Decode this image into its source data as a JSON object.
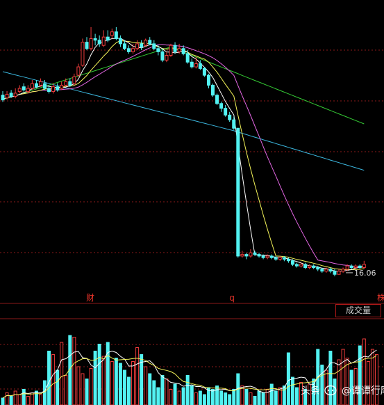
{
  "colors": {
    "up": "#f03c3c",
    "down": "#52f2f2",
    "ma5": "#ffffff",
    "ma10": "#f5f55a",
    "ma20": "#e467e4",
    "ma60": "#34c934",
    "ma120": "#3cb8e0",
    "grid": "#8b1a1a",
    "label": "#e8342a"
  },
  "main_panel": {
    "event_markers": [
      {
        "label": "财",
        "x_index": 30
      },
      {
        "label": "q",
        "x_index": 78
      },
      {
        "label": "株",
        "x_index": 128
      }
    ],
    "low_annotation": "16.06"
  },
  "volume_panel": {
    "title": "成交量"
  },
  "watermark": {
    "prefix": "头条",
    "at": "@",
    "account": "谭谭行摩"
  },
  "chart_data": [
    {
      "type": "candlestick",
      "xlabel": "",
      "ylabel": "",
      "y_scale_note": "price axis not printed",
      "grid": "horizontal dashed",
      "candles": [
        {
          "o": 61.6,
          "c": 60.4,
          "h": 62.6,
          "l": 59.9
        },
        {
          "o": 60.9,
          "c": 61.8,
          "h": 62.6,
          "l": 60.5
        },
        {
          "o": 62.1,
          "c": 61.3,
          "h": 62.9,
          "l": 60.9
        },
        {
          "o": 61.3,
          "c": 62.1,
          "h": 63.3,
          "l": 60.8
        },
        {
          "o": 62.5,
          "c": 63.3,
          "h": 64.1,
          "l": 62.0
        },
        {
          "o": 63.7,
          "c": 62.9,
          "h": 64.6,
          "l": 62.5
        },
        {
          "o": 62.5,
          "c": 63.3,
          "h": 64.1,
          "l": 62.0
        },
        {
          "o": 63.3,
          "c": 64.5,
          "h": 65.4,
          "l": 62.9
        },
        {
          "o": 64.5,
          "c": 63.7,
          "h": 65.4,
          "l": 63.3
        },
        {
          "o": 64.1,
          "c": 65.0,
          "h": 65.8,
          "l": 63.7
        },
        {
          "o": 64.5,
          "c": 63.3,
          "h": 65.4,
          "l": 62.9
        },
        {
          "o": 63.3,
          "c": 62.5,
          "h": 64.1,
          "l": 62.0
        },
        {
          "o": 62.5,
          "c": 63.7,
          "h": 64.6,
          "l": 62.0
        },
        {
          "o": 63.7,
          "c": 62.9,
          "h": 64.6,
          "l": 62.5
        },
        {
          "o": 63.3,
          "c": 64.1,
          "h": 65.0,
          "l": 62.9
        },
        {
          "o": 64.1,
          "c": 65.0,
          "h": 65.8,
          "l": 63.7
        },
        {
          "o": 65.0,
          "c": 64.1,
          "h": 65.8,
          "l": 63.7
        },
        {
          "o": 64.5,
          "c": 66.2,
          "h": 67.0,
          "l": 64.1
        },
        {
          "o": 66.6,
          "c": 68.7,
          "h": 69.5,
          "l": 66.2
        },
        {
          "o": 69.1,
          "c": 74.9,
          "h": 75.8,
          "l": 68.7
        },
        {
          "o": 74.9,
          "c": 73.3,
          "h": 76.2,
          "l": 72.9
        },
        {
          "o": 73.3,
          "c": 75.8,
          "h": 78.7,
          "l": 72.9
        },
        {
          "o": 75.8,
          "c": 75.4,
          "h": 77.0,
          "l": 74.1
        },
        {
          "o": 75.4,
          "c": 74.5,
          "h": 76.6,
          "l": 73.7
        },
        {
          "o": 74.1,
          "c": 76.2,
          "h": 77.9,
          "l": 73.7
        },
        {
          "o": 76.2,
          "c": 75.4,
          "h": 77.9,
          "l": 74.9
        },
        {
          "o": 76.6,
          "c": 77.5,
          "h": 78.3,
          "l": 75.8
        },
        {
          "o": 77.5,
          "c": 75.8,
          "h": 78.7,
          "l": 75.4
        },
        {
          "o": 75.8,
          "c": 74.5,
          "h": 76.6,
          "l": 73.7
        },
        {
          "o": 74.5,
          "c": 73.3,
          "h": 75.4,
          "l": 72.9
        },
        {
          "o": 73.3,
          "c": 72.5,
          "h": 74.1,
          "l": 72.0
        },
        {
          "o": 72.5,
          "c": 73.3,
          "h": 74.5,
          "l": 72.0
        },
        {
          "o": 73.3,
          "c": 74.5,
          "h": 75.4,
          "l": 72.9
        },
        {
          "o": 74.5,
          "c": 73.7,
          "h": 75.4,
          "l": 72.9
        },
        {
          "o": 74.1,
          "c": 75.4,
          "h": 75.8,
          "l": 73.7
        },
        {
          "o": 75.4,
          "c": 74.5,
          "h": 76.2,
          "l": 74.1
        },
        {
          "o": 74.5,
          "c": 73.3,
          "h": 75.4,
          "l": 72.9
        },
        {
          "o": 73.3,
          "c": 72.5,
          "h": 74.1,
          "l": 71.6
        },
        {
          "o": 72.5,
          "c": 70.4,
          "h": 73.3,
          "l": 69.9
        },
        {
          "o": 70.4,
          "c": 71.6,
          "h": 72.5,
          "l": 69.9
        },
        {
          "o": 71.6,
          "c": 74.1,
          "h": 74.5,
          "l": 71.2
        },
        {
          "o": 74.1,
          "c": 72.5,
          "h": 74.9,
          "l": 72.0
        },
        {
          "o": 72.5,
          "c": 73.3,
          "h": 74.5,
          "l": 72.0
        },
        {
          "o": 73.3,
          "c": 72.0,
          "h": 74.1,
          "l": 71.6
        },
        {
          "o": 72.0,
          "c": 69.9,
          "h": 72.9,
          "l": 69.5
        },
        {
          "o": 69.9,
          "c": 68.7,
          "h": 70.8,
          "l": 68.3
        },
        {
          "o": 68.7,
          "c": 69.5,
          "h": 71.2,
          "l": 68.3
        },
        {
          "o": 69.5,
          "c": 68.3,
          "h": 70.4,
          "l": 67.9
        },
        {
          "o": 68.3,
          "c": 66.6,
          "h": 68.7,
          "l": 66.2
        },
        {
          "o": 66.6,
          "c": 64.1,
          "h": 67.0,
          "l": 63.3
        },
        {
          "o": 64.1,
          "c": 61.6,
          "h": 64.5,
          "l": 61.2
        },
        {
          "o": 61.6,
          "c": 59.5,
          "h": 62.0,
          "l": 59.1
        },
        {
          "o": 59.5,
          "c": 58.3,
          "h": 60.0,
          "l": 57.4
        },
        {
          "o": 58.3,
          "c": 56.6,
          "h": 59.1,
          "l": 56.2
        },
        {
          "o": 56.6,
          "c": 55.4,
          "h": 57.4,
          "l": 54.9
        },
        {
          "o": 55.4,
          "c": 53.3,
          "h": 56.2,
          "l": 52.9
        },
        {
          "o": 53.3,
          "c": 21.2,
          "h": 21.6,
          "l": 20.8
        },
        {
          "o": 21.2,
          "c": 21.6,
          "h": 22.5,
          "l": 20.8
        },
        {
          "o": 21.6,
          "c": 21.2,
          "h": 22.0,
          "l": 20.4
        },
        {
          "o": 21.2,
          "c": 22.0,
          "h": 22.9,
          "l": 20.8
        },
        {
          "o": 22.0,
          "c": 21.6,
          "h": 22.5,
          "l": 21.2
        },
        {
          "o": 21.6,
          "c": 21.2,
          "h": 22.0,
          "l": 20.8
        },
        {
          "o": 21.2,
          "c": 20.8,
          "h": 21.6,
          "l": 20.4
        },
        {
          "o": 20.8,
          "c": 21.2,
          "h": 21.6,
          "l": 20.4
        },
        {
          "o": 21.2,
          "c": 20.8,
          "h": 21.6,
          "l": 20.4
        },
        {
          "o": 20.8,
          "c": 20.4,
          "h": 21.2,
          "l": 20.0
        },
        {
          "o": 20.4,
          "c": 20.8,
          "h": 21.2,
          "l": 20.0
        },
        {
          "o": 20.8,
          "c": 20.4,
          "h": 21.2,
          "l": 19.9
        },
        {
          "o": 20.4,
          "c": 20.0,
          "h": 20.8,
          "l": 19.5
        },
        {
          "o": 20.0,
          "c": 19.1,
          "h": 20.4,
          "l": 18.7
        },
        {
          "o": 19.1,
          "c": 18.7,
          "h": 19.5,
          "l": 18.3
        },
        {
          "o": 18.7,
          "c": 19.1,
          "h": 19.5,
          "l": 18.3
        },
        {
          "o": 19.1,
          "c": 18.3,
          "h": 19.5,
          "l": 17.9
        },
        {
          "o": 18.3,
          "c": 18.7,
          "h": 19.1,
          "l": 17.9
        },
        {
          "o": 18.7,
          "c": 18.3,
          "h": 19.1,
          "l": 17.9
        },
        {
          "o": 18.3,
          "c": 17.9,
          "h": 18.7,
          "l": 17.4
        },
        {
          "o": 17.9,
          "c": 17.4,
          "h": 18.3,
          "l": 17.0
        },
        {
          "o": 17.4,
          "c": 17.9,
          "h": 18.3,
          "l": 17.0
        },
        {
          "o": 17.9,
          "c": 17.4,
          "h": 18.3,
          "l": 16.9
        },
        {
          "o": 17.4,
          "c": 16.6,
          "h": 17.9,
          "l": 16.1
        },
        {
          "o": 16.6,
          "c": 17.4,
          "h": 17.9,
          "l": 16.6
        },
        {
          "o": 17.4,
          "c": 17.9,
          "h": 18.3,
          "l": 17.0
        },
        {
          "o": 17.9,
          "c": 18.7,
          "h": 19.1,
          "l": 17.4
        },
        {
          "o": 18.7,
          "c": 18.3,
          "h": 19.1,
          "l": 17.9
        },
        {
          "o": 18.3,
          "c": 18.7,
          "h": 19.1,
          "l": 17.9
        },
        {
          "o": 18.7,
          "c": 18.3,
          "h": 19.1,
          "l": 17.9
        },
        {
          "o": 18.3,
          "c": 19.1,
          "h": 20.0,
          "l": 17.9
        }
      ]
    },
    {
      "type": "bar",
      "title": "成交量",
      "series": [
        {
          "values": [
            8,
            14,
            10,
            16,
            12,
            18,
            10,
            14,
            16,
            12,
            28,
            62,
            58,
            40,
            72,
            34,
            80,
            78,
            44,
            36,
            30,
            42,
            62,
            70,
            56,
            72,
            50,
            54,
            48,
            40,
            32,
            50,
            66,
            58,
            44,
            36,
            28,
            20,
            34,
            30,
            18,
            24,
            16,
            20,
            34,
            22,
            14,
            16,
            12,
            20,
            18,
            22,
            16,
            14,
            12,
            18,
            36,
            22,
            18,
            14,
            10,
            16,
            14,
            18,
            24,
            16,
            20,
            22,
            60,
            32,
            20,
            26,
            18,
            24,
            30,
            64,
            46,
            40,
            62,
            30,
            52,
            64,
            54,
            40,
            42,
            68,
            76,
            50,
            64,
            58
          ]
        }
      ]
    }
  ]
}
